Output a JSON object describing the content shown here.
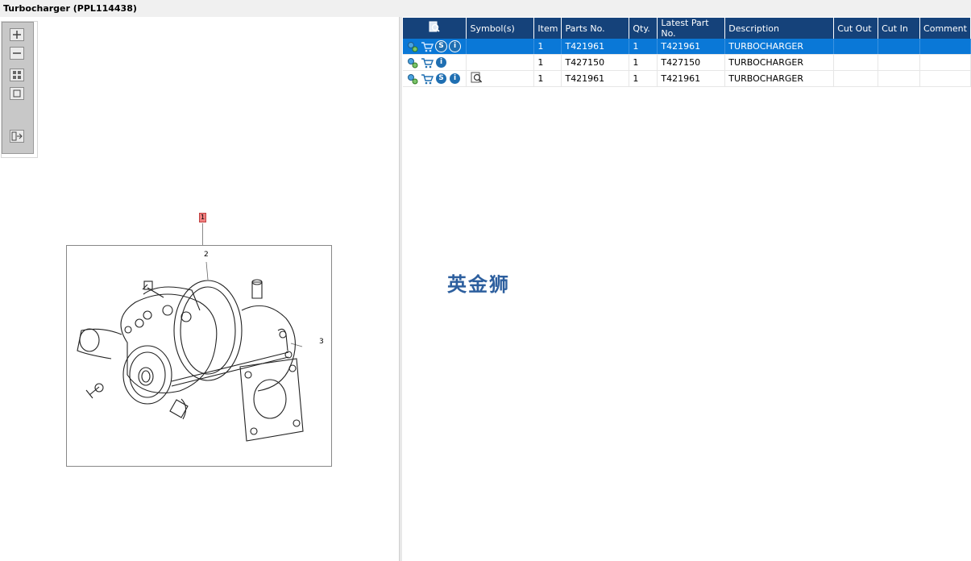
{
  "window": {
    "title": "Turbocharger (PPL114438)"
  },
  "drawing": {
    "callout_main": "1",
    "callout_labels": [
      "2",
      "3"
    ]
  },
  "zoom_toolbar": {
    "buttons": [
      "zoom-in",
      "zoom-out",
      "fit-all",
      "actual-size",
      "toggle-panel"
    ]
  },
  "table": {
    "columns": [
      "Symbol(s)",
      "Item",
      "Parts No.",
      "Qty.",
      "Latest Part No.",
      "Description",
      "Cut Out",
      "Cut In",
      "Comment"
    ],
    "rows": [
      {
        "item": "1",
        "parts_no": "T421961",
        "qty": "1",
        "latest_part_no": "T421961",
        "description": "TURBOCHARGER",
        "cut_out": "",
        "cut_in": "",
        "comment": "",
        "icons": [
          "gears-icon",
          "cart-icon",
          "s-badge-icon",
          "info-icon"
        ],
        "symbol": "",
        "selected": true
      },
      {
        "item": "1",
        "parts_no": "T427150",
        "qty": "1",
        "latest_part_no": "T427150",
        "description": "TURBOCHARGER",
        "cut_out": "",
        "cut_in": "",
        "comment": "",
        "icons": [
          "gears-icon",
          "cart-icon",
          "info-icon"
        ],
        "symbol": "",
        "selected": false
      },
      {
        "item": "1",
        "parts_no": "T421961",
        "qty": "1",
        "latest_part_no": "T421961",
        "description": "TURBOCHARGER",
        "cut_out": "",
        "cut_in": "",
        "comment": "",
        "icons": [
          "gears-icon",
          "cart-icon",
          "s-badge-icon",
          "info-icon"
        ],
        "symbol": "magnifier-doc-icon",
        "selected": false
      }
    ]
  },
  "watermark": {
    "text": "英金狮"
  },
  "colors": {
    "header_bg": "#15427a",
    "selected_row": "#0a78d7",
    "watermark": "#2d5f9e",
    "callout_flag": "#f08080"
  }
}
